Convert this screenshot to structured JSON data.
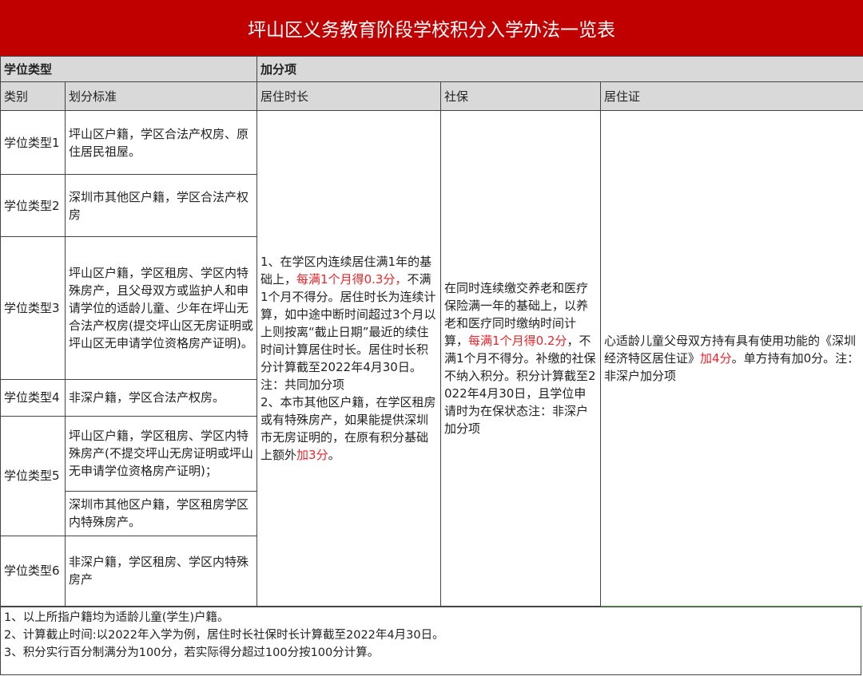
{
  "title": "坪山区义务教育阶段学校积分入学办法一览表",
  "header": {
    "group_left": "学位类型",
    "group_right": "加分项",
    "col_type": "类别",
    "col_criteria": "划分标准",
    "col_residence": "居住时长",
    "col_social": "社保",
    "col_permit": "居住证"
  },
  "rows": [
    {
      "type": "学位类型1",
      "criteria": "坪山区户籍，学区合法产权房、原住居民祖屋。"
    },
    {
      "type": "学位类型2",
      "criteria": "深圳市其他区户籍，学区合法产权房"
    },
    {
      "type": "学位类型3",
      "criteria": "坪山区户籍，学区租房、学区内特殊房产，且父母双方或监护人和申请学位的适龄儿童、少年在坪山无合法产权房(提交坪山区无房证明或坪山区无申请学位资格房产证明)。"
    },
    {
      "type": "学位类型4",
      "criteria": "非深户籍，学区合法产权房。"
    },
    {
      "type": "学位类型5",
      "criteria_a": "坪山区户籍，学区租房、学区内特殊房产(不提交坪山无房证明或坪山无申请学位资格房产证明)；",
      "criteria_b": "深圳市其他区户籍，学区租房学区内特殊房产。"
    },
    {
      "type": "学位类型6",
      "criteria": "非深户籍，学区租房、学区内特殊房产"
    }
  ],
  "residence": {
    "p1": "1、在学区内连续居住满1年的基础上，",
    "p1_hl": "每满1个月得0.3分，",
    "p2": "不满1个月不得分。居住时长为连续计算，如中途中断时间超过3个月以上则按离“截止日期”最近的续住时间计算居住时长。居住时长积分计算截至2022年4月30日。注：共同加分项",
    "p3": "2、本市其他区户籍，在学区租房或有特殊房产，如果能提供深圳市无房证明的，在原有积分基础上额外",
    "p3_hl": "加3分",
    "p3_end": "。"
  },
  "social": {
    "p1": "在同时连续缴交养老和医疗保险满一年的基础上，以养老和医疗同时缴纳时间计算，",
    "p1_hl": "每满1个月得0.2分",
    "p2": "，不满1个月不得分。补缴的社保不纳入积分。积分计算截至2022年4月30日，且学位申请时为在保状态注：非深户加分项"
  },
  "permit": {
    "p1": "心适龄儿童父母双方持有具有使用功能的《深圳经济特区居住证》",
    "p1_hl": "加4分",
    "p2": "。单方持有加0分。注：非深户加分项"
  },
  "notes": [
    "1、以上所指户籍均为适龄儿童(学生)户籍。",
    "2、计算截止时间:以2022年入学为例，居住时长社保时长计算截至2022年4月30日。",
    "3、积分实行百分制满分为100分，若实际得分超过100分按100分计算。"
  ],
  "colors": {
    "title_bg": "#c00000",
    "header_bg": "#d9d9d9",
    "highlight": "#e8262c"
  }
}
